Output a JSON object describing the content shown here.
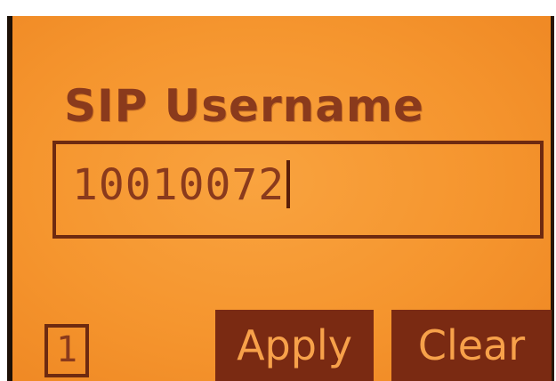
{
  "screen": {
    "title": "SIP Username",
    "username_value": "10010072",
    "page_indicator": "1",
    "softkeys": {
      "apply_label": "Apply",
      "clear_label": "Clear"
    }
  },
  "colors": {
    "lcd_background": "#f5952e",
    "lcd_text": "#8a3a1c",
    "softkey_background": "#7a2a12",
    "softkey_text": "#f7a14a"
  }
}
